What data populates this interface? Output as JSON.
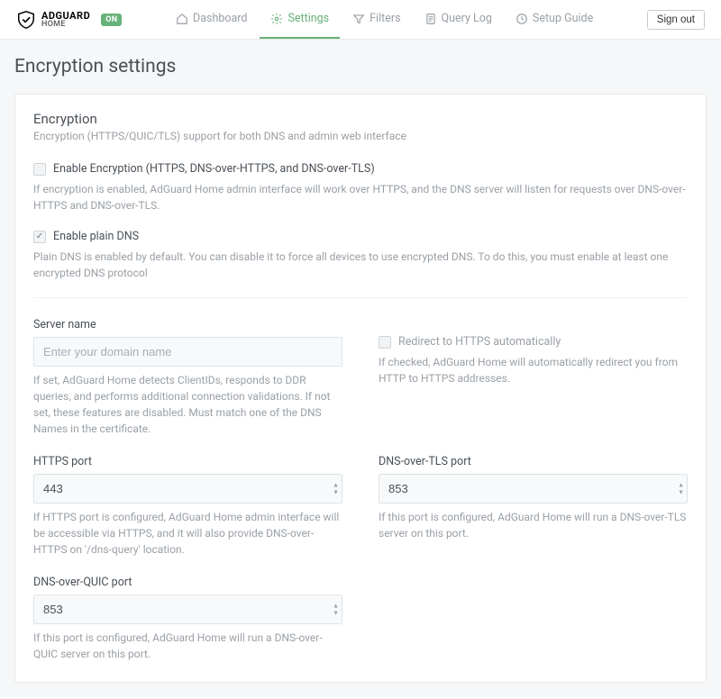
{
  "brand": {
    "line1": "ADGUARD",
    "line2": "HOME",
    "status": "ON"
  },
  "nav": {
    "dashboard": "Dashboard",
    "settings": "Settings",
    "filters": "Filters",
    "querylog": "Query Log",
    "setup": "Setup Guide"
  },
  "signout": "Sign out",
  "page_title": "Encryption settings",
  "card": {
    "title": "Encryption",
    "subtitle": "Encryption (HTTPS/QUIC/TLS) support for both DNS and admin web interface"
  },
  "enable_enc": {
    "label": "Enable Encryption (HTTPS, DNS-over-HTTPS, and DNS-over-TLS)",
    "help": "If encryption is enabled, AdGuard Home admin interface will work over HTTPS, and the DNS server will listen for requests over DNS-over-HTTPS and DNS-over-TLS."
  },
  "plain_dns": {
    "label": "Enable plain DNS",
    "help": "Plain DNS is enabled by default. You can disable it to force all devices to use encrypted DNS. To do this, you must enable at least one encrypted DNS protocol"
  },
  "server_name": {
    "label": "Server name",
    "placeholder": "Enter your domain name",
    "help": "If set, AdGuard Home detects ClientIDs, responds to DDR queries, and performs additional connection validations. If not set, these features are disabled. Must match one of the DNS Names in the certificate."
  },
  "redirect": {
    "label": "Redirect to HTTPS automatically",
    "help": "If checked, AdGuard Home will automatically redirect you from HTTP to HTTPS addresses."
  },
  "https_port": {
    "label": "HTTPS port",
    "value": "443",
    "help": "If HTTPS port is configured, AdGuard Home admin interface will be accessible via HTTPS, and it will also provide DNS-over-HTTPS on '/dns-query' location."
  },
  "dot_port": {
    "label": "DNS-over-TLS port",
    "value": "853",
    "help": "If this port is configured, AdGuard Home will run a DNS-over-TLS server on this port."
  },
  "doq_port": {
    "label": "DNS-over-QUIC port",
    "value": "853",
    "help": "If this port is configured, AdGuard Home will run a DNS-over-QUIC server on this port."
  }
}
